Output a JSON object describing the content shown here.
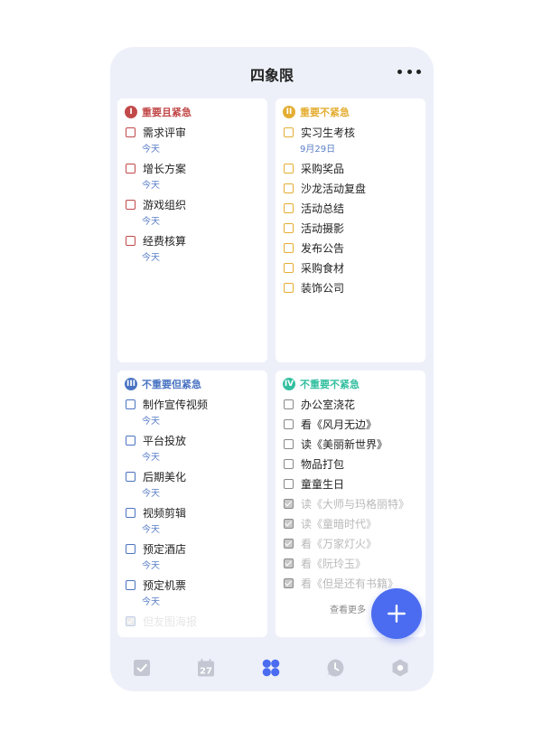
{
  "header": {
    "title": "四象限"
  },
  "colors": {
    "q1": "#c24949",
    "q2": "#e4ae33",
    "q3": "#4a74c2",
    "q4": "#33bfa0",
    "accent": "#4b6cf0"
  },
  "quadrants": [
    {
      "badge": "I",
      "title": "重要且紧急",
      "items": [
        {
          "label": "需求评审",
          "date": "今天"
        },
        {
          "label": "增长方案",
          "date": "今天"
        },
        {
          "label": "游戏组织",
          "date": "今天"
        },
        {
          "label": "经费核算",
          "date": "今天"
        }
      ]
    },
    {
      "badge": "II",
      "title": "重要不紧急",
      "items": [
        {
          "label": "实习生考核",
          "date": "9月29日"
        },
        {
          "label": "采购奖品"
        },
        {
          "label": "沙龙活动复盘"
        },
        {
          "label": "活动总结"
        },
        {
          "label": "活动摄影"
        },
        {
          "label": "发布公告"
        },
        {
          "label": "采购食材"
        },
        {
          "label": "装饰公司"
        }
      ]
    },
    {
      "badge": "III",
      "title": "不重要但紧急",
      "items": [
        {
          "label": "制作宣传视频",
          "date": "今天"
        },
        {
          "label": "平台投放",
          "date": "今天"
        },
        {
          "label": "后期美化",
          "date": "今天"
        },
        {
          "label": "视频剪辑",
          "date": "今天"
        },
        {
          "label": "预定酒店",
          "date": "今天"
        },
        {
          "label": "预定机票",
          "date": "今天"
        },
        {
          "label": "但友图海报",
          "done": true
        }
      ]
    },
    {
      "badge": "IV",
      "title": "不重要不紧急",
      "items": [
        {
          "label": "办公室浇花"
        },
        {
          "label": "看《风月无边》"
        },
        {
          "label": "读《美丽新世界》"
        },
        {
          "label": "物品打包"
        },
        {
          "label": "童童生日"
        },
        {
          "label": "读《大师与玛格丽特》",
          "done": true
        },
        {
          "label": "读《童暗时代》",
          "done": true
        },
        {
          "label": "看《万家灯火》",
          "done": true
        },
        {
          "label": "看《阮玲玉》",
          "done": true
        },
        {
          "label": "看《但是还有书籍》",
          "done": true
        }
      ],
      "see_more": "查看更多"
    }
  ],
  "nav": {
    "items": [
      {
        "icon": "task-check-icon"
      },
      {
        "icon": "calendar-icon",
        "label": "27"
      },
      {
        "icon": "four-quadrant-icon",
        "active": true
      },
      {
        "icon": "clock-icon"
      },
      {
        "icon": "hexagon-icon"
      }
    ]
  },
  "fab": {
    "icon": "plus-icon"
  }
}
